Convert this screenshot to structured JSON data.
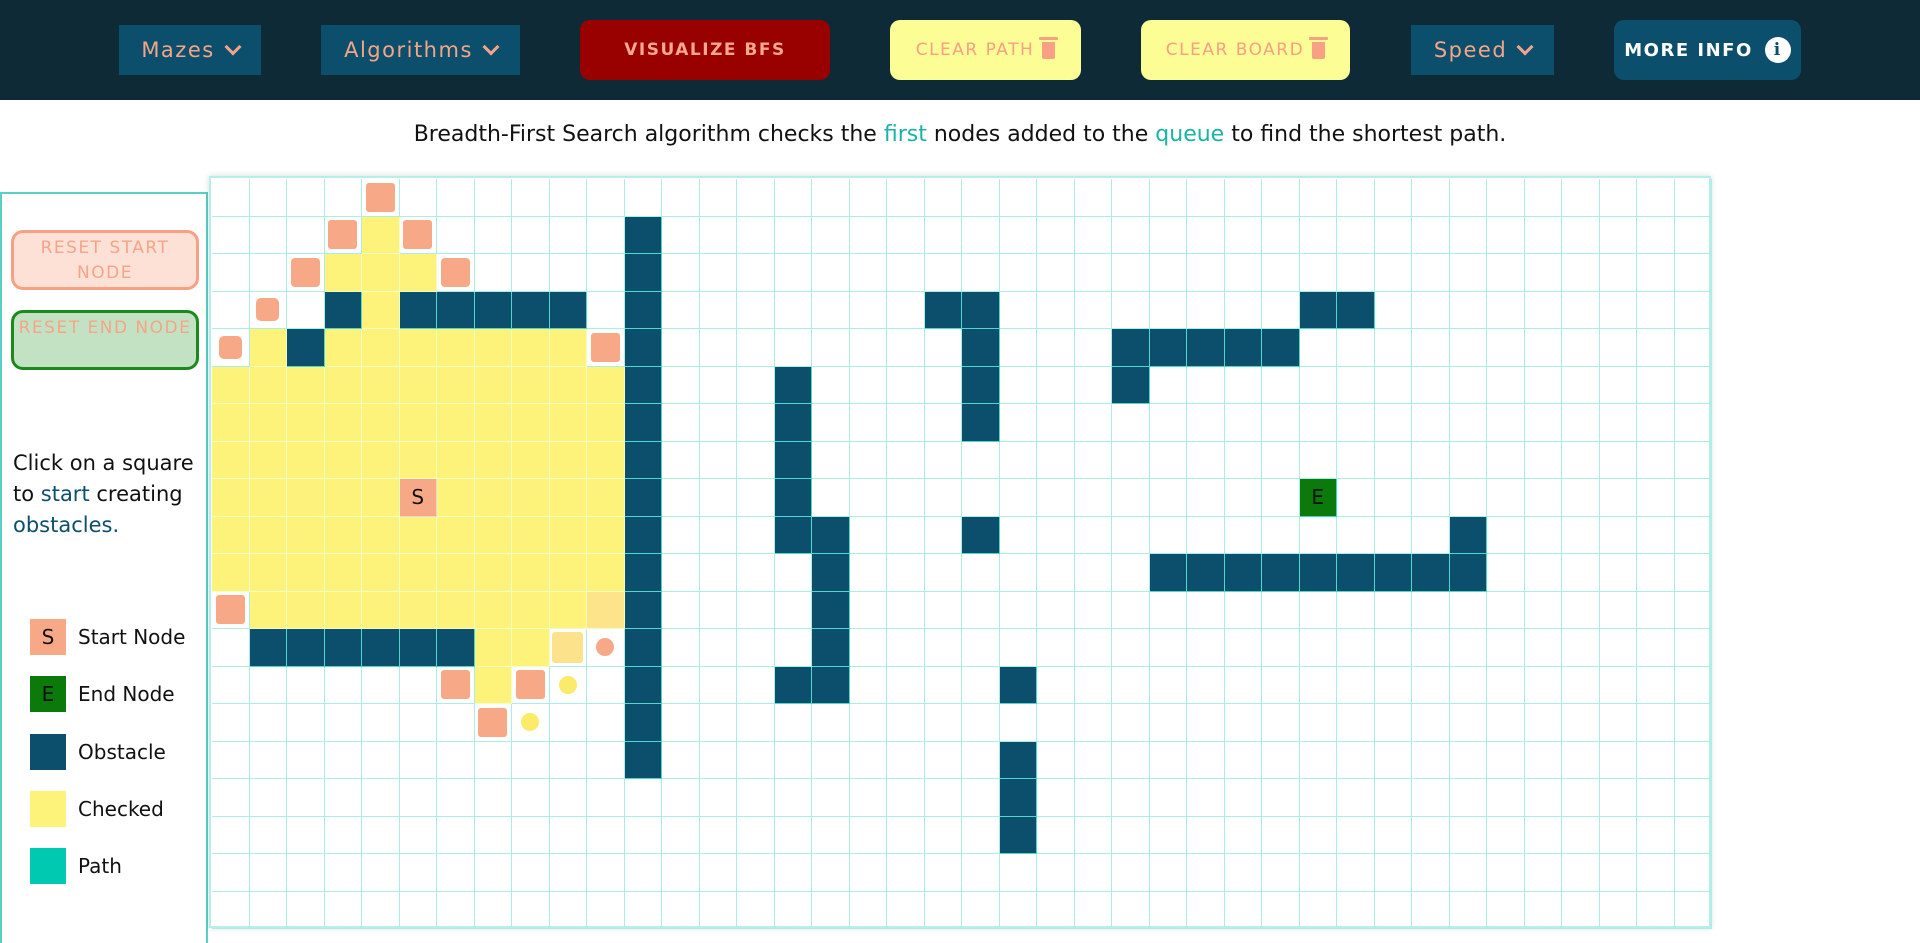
{
  "navbar": {
    "mazes_label": "Mazes",
    "algorithms_label": "Algorithms",
    "visualize_label": "VISUALIZE BFS",
    "clear_path_label": "CLEAR PATH",
    "clear_board_label": "CLEAR BOARD",
    "speed_label": "Speed",
    "more_info_label": "MORE INFO",
    "info_glyph": "i"
  },
  "description": {
    "part1": "Breadth-First Search algorithm checks the ",
    "highlight1": "first",
    "part2": " nodes added to the ",
    "highlight2": "queue",
    "part3": " to find the shortest path."
  },
  "sidebar": {
    "reset_start_label": "RESET START NODE",
    "reset_end_label": "RESET END NODE",
    "hint_part1": "Click on a square to ",
    "hint_start": "start",
    "hint_part2": " creating ",
    "hint_obstacles": "obstacles."
  },
  "legend": [
    {
      "label": "Start Node",
      "glyph": "S",
      "color": "#f7a886"
    },
    {
      "label": "End Node",
      "glyph": "E",
      "color": "#0b7a0b"
    },
    {
      "label": "Obstacle",
      "glyph": "",
      "color": "#0c4f6c"
    },
    {
      "label": "Checked",
      "glyph": "",
      "color": "#fdf37a"
    },
    {
      "label": "Path",
      "glyph": "",
      "color": "#00c9b1"
    }
  ],
  "grid": {
    "columns": 40,
    "rows": 20,
    "start": {
      "row": 8,
      "col": 5,
      "glyph": "S"
    },
    "end": {
      "row": 8,
      "col": 29,
      "glyph": "E"
    },
    "walls": [
      [
        1,
        11
      ],
      [
        2,
        11
      ],
      [
        3,
        11
      ],
      [
        4,
        11
      ],
      [
        5,
        11
      ],
      [
        6,
        11
      ],
      [
        7,
        11
      ],
      [
        8,
        11
      ],
      [
        9,
        11
      ],
      [
        10,
        11
      ],
      [
        11,
        11
      ],
      [
        12,
        11
      ],
      [
        13,
        11
      ],
      [
        14,
        11
      ],
      [
        15,
        11
      ],
      [
        3,
        3
      ],
      [
        3,
        5
      ],
      [
        3,
        6
      ],
      [
        3,
        7
      ],
      [
        3,
        8
      ],
      [
        3,
        9
      ],
      [
        4,
        2
      ],
      [
        12,
        1
      ],
      [
        12,
        2
      ],
      [
        12,
        3
      ],
      [
        12,
        4
      ],
      [
        12,
        5
      ],
      [
        12,
        6
      ],
      [
        5,
        15
      ],
      [
        6,
        15
      ],
      [
        7,
        15
      ],
      [
        8,
        15
      ],
      [
        9,
        15
      ],
      [
        9,
        16
      ],
      [
        10,
        16
      ],
      [
        11,
        16
      ],
      [
        12,
        16
      ],
      [
        13,
        15
      ],
      [
        13,
        16
      ],
      [
        3,
        19
      ],
      [
        3,
        20
      ],
      [
        4,
        20
      ],
      [
        5,
        20
      ],
      [
        6,
        20
      ],
      [
        9,
        20
      ],
      [
        13,
        21
      ],
      [
        15,
        21
      ],
      [
        16,
        21
      ],
      [
        17,
        21
      ],
      [
        4,
        24
      ],
      [
        4,
        25
      ],
      [
        4,
        26
      ],
      [
        4,
        27
      ],
      [
        4,
        28
      ],
      [
        5,
        24
      ],
      [
        3,
        29
      ],
      [
        3,
        30
      ],
      [
        10,
        25
      ],
      [
        10,
        26
      ],
      [
        10,
        27
      ],
      [
        10,
        28
      ],
      [
        10,
        29
      ],
      [
        10,
        30
      ],
      [
        10,
        31
      ],
      [
        10,
        32
      ],
      [
        10,
        33
      ],
      [
        9,
        33
      ]
    ],
    "visited": [
      [
        1,
        4
      ],
      [
        2,
        3
      ],
      [
        2,
        4
      ],
      [
        2,
        5
      ],
      [
        3,
        4
      ],
      [
        4,
        1
      ],
      [
        4,
        3
      ],
      [
        4,
        4
      ],
      [
        4,
        5
      ],
      [
        4,
        6
      ],
      [
        4,
        7
      ],
      [
        4,
        8
      ],
      [
        4,
        9
      ],
      [
        5,
        0
      ],
      [
        5,
        1
      ],
      [
        5,
        2
      ],
      [
        5,
        3
      ],
      [
        5,
        4
      ],
      [
        5,
        5
      ],
      [
        5,
        6
      ],
      [
        5,
        7
      ],
      [
        5,
        8
      ],
      [
        5,
        9
      ],
      [
        5,
        10
      ],
      [
        6,
        0
      ],
      [
        6,
        1
      ],
      [
        6,
        2
      ],
      [
        6,
        3
      ],
      [
        6,
        4
      ],
      [
        6,
        5
      ],
      [
        6,
        6
      ],
      [
        6,
        7
      ],
      [
        6,
        8
      ],
      [
        6,
        9
      ],
      [
        6,
        10
      ],
      [
        7,
        0
      ],
      [
        7,
        1
      ],
      [
        7,
        2
      ],
      [
        7,
        3
      ],
      [
        7,
        4
      ],
      [
        7,
        5
      ],
      [
        7,
        6
      ],
      [
        7,
        7
      ],
      [
        7,
        8
      ],
      [
        7,
        9
      ],
      [
        7,
        10
      ],
      [
        8,
        0
      ],
      [
        8,
        1
      ],
      [
        8,
        2
      ],
      [
        8,
        3
      ],
      [
        8,
        4
      ],
      [
        8,
        6
      ],
      [
        8,
        7
      ],
      [
        8,
        8
      ],
      [
        8,
        9
      ],
      [
        8,
        10
      ],
      [
        9,
        0
      ],
      [
        9,
        1
      ],
      [
        9,
        2
      ],
      [
        9,
        3
      ],
      [
        9,
        4
      ],
      [
        9,
        5
      ],
      [
        9,
        6
      ],
      [
        9,
        7
      ],
      [
        9,
        8
      ],
      [
        9,
        9
      ],
      [
        9,
        10
      ],
      [
        10,
        0
      ],
      [
        10,
        1
      ],
      [
        10,
        2
      ],
      [
        10,
        3
      ],
      [
        10,
        4
      ],
      [
        10,
        5
      ],
      [
        10,
        6
      ],
      [
        10,
        7
      ],
      [
        10,
        8
      ],
      [
        10,
        9
      ],
      [
        10,
        10
      ],
      [
        11,
        1
      ],
      [
        11,
        2
      ],
      [
        11,
        3
      ],
      [
        11,
        4
      ],
      [
        11,
        5
      ],
      [
        11,
        6
      ],
      [
        11,
        7
      ],
      [
        11,
        8
      ],
      [
        11,
        9
      ],
      [
        12,
        7
      ],
      [
        12,
        8
      ],
      [
        13,
        7
      ]
    ],
    "fade_visited": [
      [
        11,
        10
      ]
    ],
    "fade_visited2": [
      [
        12,
        9
      ]
    ],
    "frontier": [
      [
        0,
        4
      ],
      [
        1,
        3
      ],
      [
        1,
        5
      ],
      [
        4,
        10
      ],
      [
        11,
        0
      ],
      [
        13,
        6
      ],
      [
        13,
        8
      ],
      [
        14,
        7
      ]
    ],
    "frontier_md": [
      [
        2,
        2
      ],
      [
        2,
        6
      ]
    ],
    "frontier_sm": [
      [
        3,
        1
      ],
      [
        4,
        0
      ]
    ],
    "frontier_xs": [
      [
        12,
        10
      ]
    ],
    "dots_yellow": [
      [
        13,
        9
      ],
      [
        14,
        8
      ]
    ]
  }
}
